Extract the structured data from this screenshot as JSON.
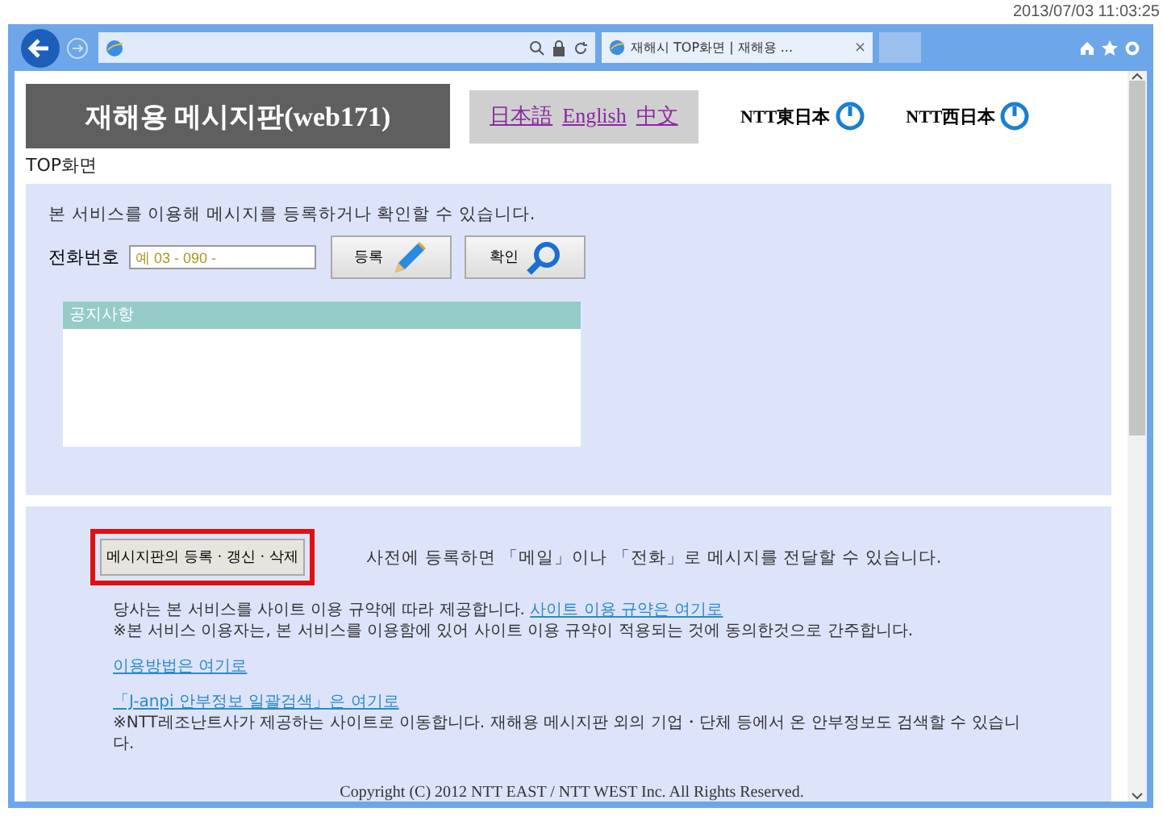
{
  "timestamp": "2013/07/03 11:03:25",
  "browser": {
    "tab_title": "재해시 TOP화면 | 재해용 ...",
    "tab_close": "×"
  },
  "header": {
    "title": "재해용 메시지판(web171)",
    "languages": [
      {
        "label": "日本語"
      },
      {
        "label": "English"
      },
      {
        "label": "中文"
      }
    ],
    "logos": [
      {
        "label": "NTT東日本"
      },
      {
        "label": "NTT西日本"
      }
    ]
  },
  "breadcrumb": "TOP화면",
  "top_panel": {
    "intro": "본 서비스를 이용해 메시지를 등록하거나 확인할 수 있습니다.",
    "phone_label": "전화번호",
    "phone_placeholder": "예 03 - 090 -",
    "buttons": [
      {
        "label": "등록",
        "kind": "pencil"
      },
      {
        "label": "확인",
        "kind": "search"
      }
    ],
    "notice_title": "공지사항"
  },
  "bottom_panel": {
    "manage_button": "메시지판의 등록 · 갱신 · 삭제",
    "highlighted": true,
    "manage_text": "사전에 등록하면 「메일」이나 「전화」로 메시지를 전달할 수 있습니다.",
    "terms_text": "당사는 본 서비스를 사이트 이용 규약에 따라 제공합니다.",
    "terms_link": "사이트 이용 규약은 여기로",
    "terms_note": "※본 서비스 이용자는, 본 서비스를 이용함에 있어 사이트 이용 규약이 적용되는 것에 동의한것으로 간주합니다.",
    "usage_link": "이용방법은 여기로",
    "janpi_link": "「J-anpi 안부정보 일괄검색」은 여기로",
    "janpi_note": "※NTT레조난트사가 제공하는 사이트로 이동합니다. 재해용 메시지판 외의 기업・단체 등에서 온 안부정보도 검색할 수 있습니다.",
    "copyright": "Copyright (C) 2012 NTT EAST / NTT WEST Inc. All Rights Reserved."
  }
}
